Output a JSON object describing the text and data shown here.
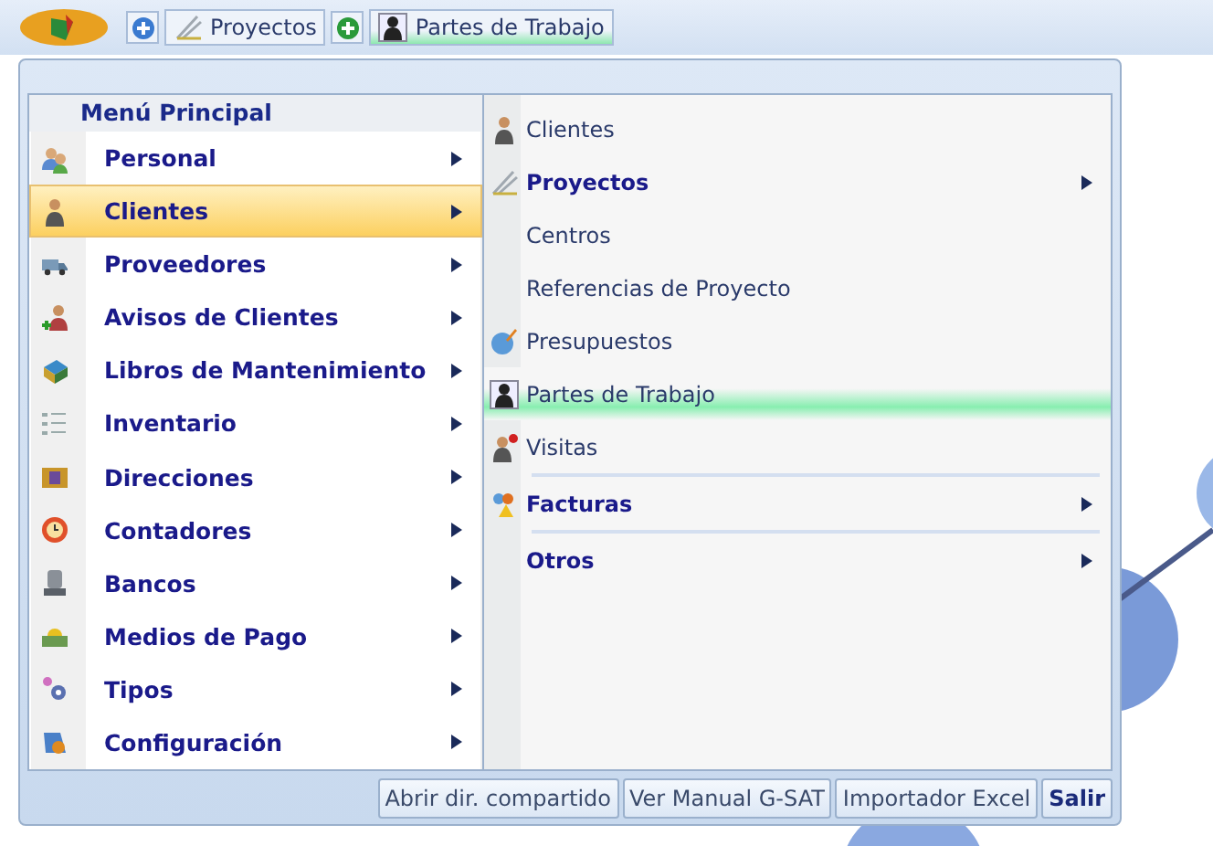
{
  "quick_access": [
    {
      "kind": "add"
    },
    {
      "kind": "tab",
      "label": "Proyectos",
      "selected": false
    },
    {
      "kind": "add"
    },
    {
      "kind": "tab",
      "label": "Partes de Trabajo",
      "selected": true
    }
  ],
  "main_menu": {
    "title": "Menú Principal",
    "items": [
      {
        "label": "Personal",
        "selected": false
      },
      {
        "label": "Clientes",
        "selected": true
      },
      {
        "label": "Proveedores",
        "selected": false
      },
      {
        "label": "Avisos de Clientes",
        "selected": false
      },
      {
        "label": "Libros de Mantenimiento",
        "selected": false
      },
      {
        "label": "Inventario",
        "selected": false
      },
      {
        "label": "Direcciones",
        "selected": false
      },
      {
        "label": "Contadores",
        "selected": false
      },
      {
        "label": "Bancos",
        "selected": false
      },
      {
        "label": "Medios de Pago",
        "selected": false
      },
      {
        "label": "Tipos",
        "selected": false
      },
      {
        "label": "Configuración",
        "selected": false
      }
    ]
  },
  "submenu": {
    "items": [
      {
        "kind": "item",
        "label": "Clientes",
        "selected": false
      },
      {
        "kind": "submenu",
        "label": "Proyectos",
        "selected": false
      },
      {
        "kind": "item",
        "label": "Centros",
        "selected": false
      },
      {
        "kind": "item",
        "label": "Referencias de Proyecto",
        "selected": false
      },
      {
        "kind": "item",
        "label": "Presupuestos",
        "selected": false
      },
      {
        "kind": "item",
        "label": "Partes de Trabajo",
        "selected": true
      },
      {
        "kind": "item",
        "label": "Visitas",
        "selected": false
      },
      {
        "kind": "separator"
      },
      {
        "kind": "submenu",
        "label": "Facturas",
        "selected": false
      },
      {
        "kind": "separator"
      },
      {
        "kind": "submenu",
        "label": "Otros",
        "selected": false
      }
    ]
  },
  "footer_buttons": [
    {
      "label": "Abrir dir. compartido",
      "kind": "normal"
    },
    {
      "label": "Ver Manual G-SAT",
      "kind": "normal"
    },
    {
      "label": "Importador Excel",
      "kind": "normal"
    },
    {
      "label": "Salir",
      "kind": "primary"
    }
  ]
}
